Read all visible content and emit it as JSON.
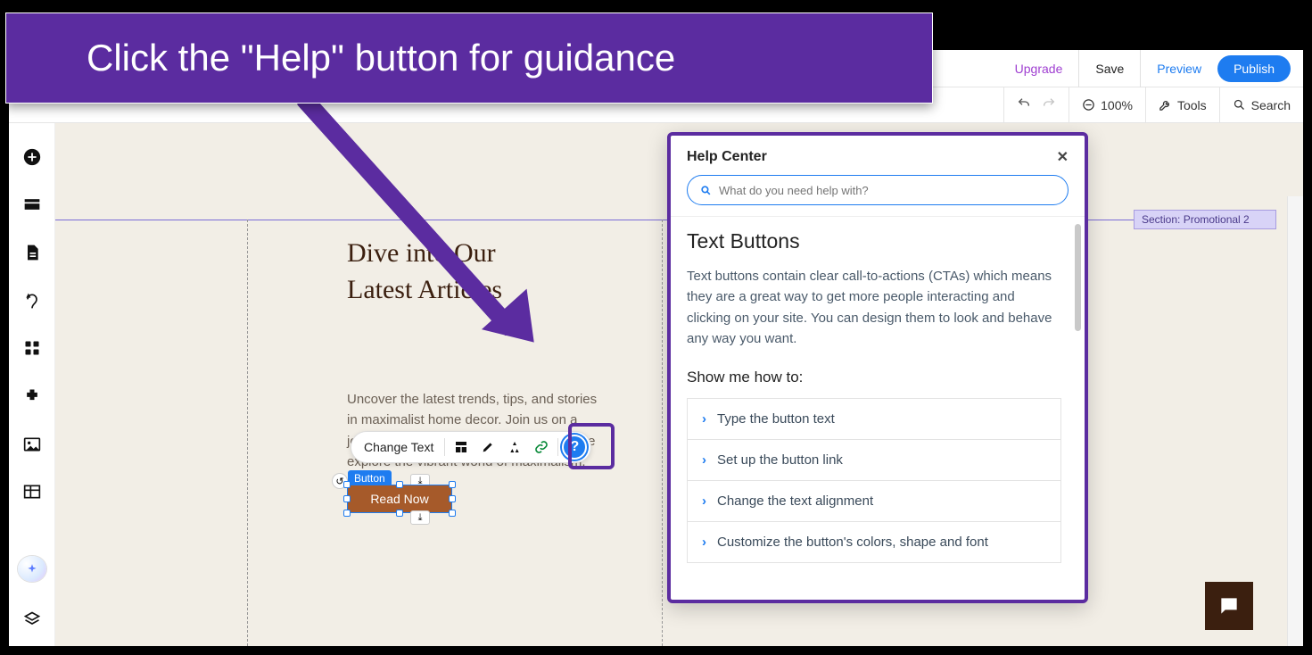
{
  "instruction": {
    "text": "Click the \"Help\" button for guidance"
  },
  "header": {
    "upgrade": "Upgrade",
    "save": "Save",
    "preview": "Preview",
    "publish": "Publish"
  },
  "toolbar": {
    "zoom": "100%",
    "tools": "Tools",
    "search": "Search"
  },
  "section_tag": "Section: Promotional 2",
  "canvas": {
    "heading_line1": "Dive into Our",
    "heading_line2": "Latest Articles",
    "body": "Uncover the latest trends, tips, and stories in maximalist home decor. Join us on a journey of creativity and expression as we explore the vibrant world of maximalism.",
    "element_toolbar": {
      "change_text": "Change Text"
    },
    "selected_label": "Button",
    "button_text": "Read Now"
  },
  "help_center": {
    "title": "Help Center",
    "search_placeholder": "What do you need help with?",
    "article_title": "Text Buttons",
    "article_desc": "Text buttons contain clear call-to-actions (CTAs) which means they are a great way to get more people interacting and clicking on your site. You can design them to look and behave any way you want.",
    "howto_heading": "Show me how to:",
    "items": [
      "Type the button text",
      "Set up the button link",
      "Change the text alignment",
      "Customize the button's colors, shape and font"
    ]
  }
}
